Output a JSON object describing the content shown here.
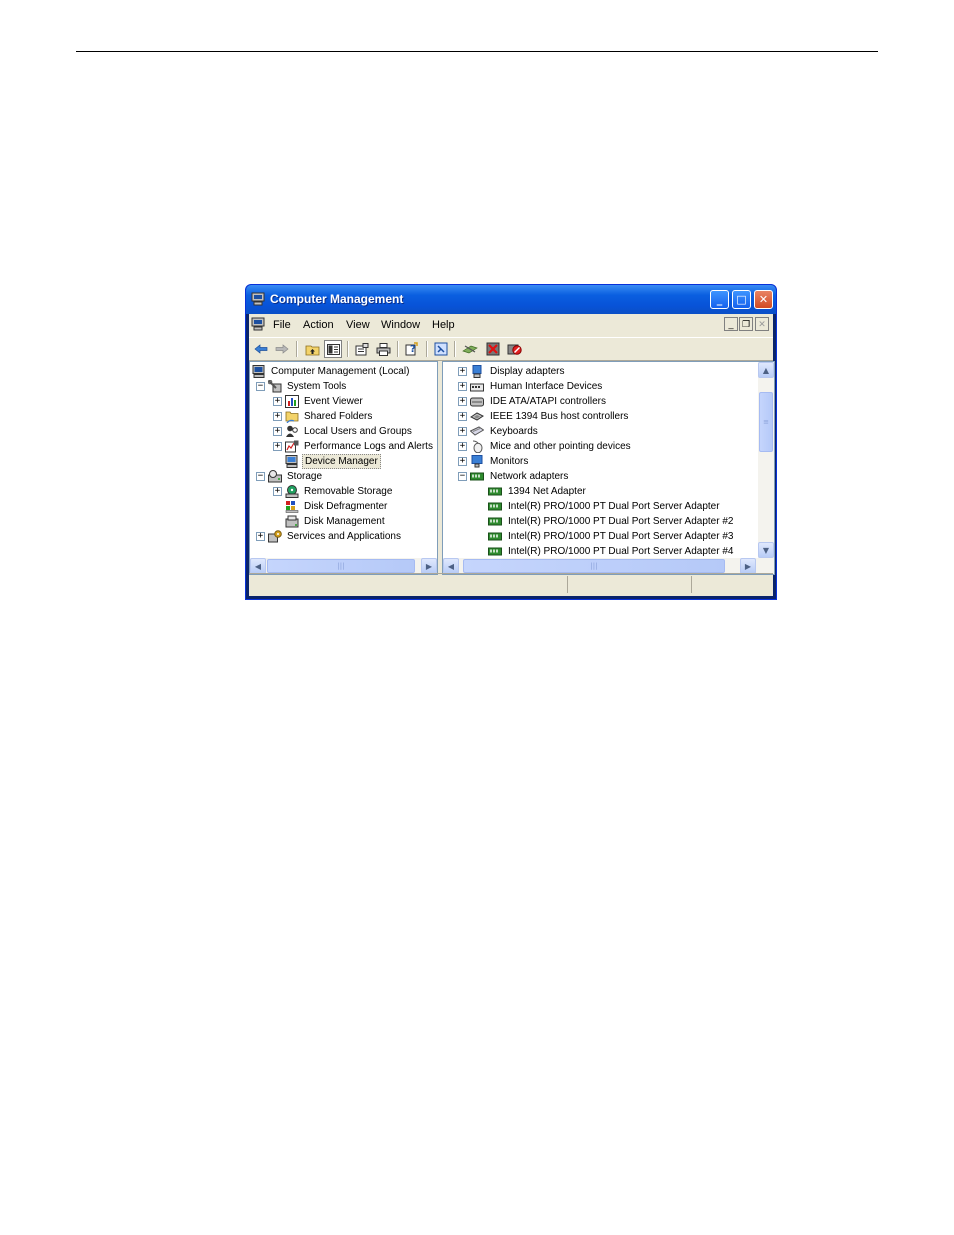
{
  "window": {
    "title": "Computer Management",
    "minimize_glyph": "_",
    "maximize_glyph": "□",
    "close_glyph": "✕"
  },
  "menu": {
    "items": [
      "File",
      "Action",
      "View",
      "Window",
      "Help"
    ],
    "mdi_minimize": "_",
    "mdi_restore": "❐",
    "mdi_close": "✕"
  },
  "toolbar": {
    "icons": [
      "back-arrow-icon",
      "forward-arrow-icon",
      "up-folder-icon",
      "show-hide-console-tree-icon",
      "properties-icon",
      "print-icon",
      "help-icon",
      "refresh-icon",
      "scan-hardware-icon",
      "uninstall-icon",
      "disable-icon"
    ]
  },
  "left_tree": {
    "root": "Computer Management (Local)",
    "system_tools": "System Tools",
    "event_viewer": "Event Viewer",
    "shared_folders": "Shared Folders",
    "local_users": "Local Users and Groups",
    "perf_logs": "Performance Logs and Alerts",
    "device_manager": "Device Manager",
    "storage": "Storage",
    "removable_storage": "Removable Storage",
    "disk_defrag": "Disk Defragmenter",
    "disk_mgmt": "Disk Management",
    "services_apps": "Services and Applications"
  },
  "right_tree": {
    "display_adapters": "Display adapters",
    "hid": "Human Interface Devices",
    "ide": "IDE ATA/ATAPI controllers",
    "ieee1394": "IEEE 1394 Bus host controllers",
    "keyboards": "Keyboards",
    "mice": "Mice and other pointing devices",
    "monitors": "Monitors",
    "network_adapters": "Network adapters",
    "adapter_1394": "1394 Net Adapter",
    "adapter_intel_1": "Intel(R) PRO/1000 PT Dual Port Server Adapter",
    "adapter_intel_2": "Intel(R) PRO/1000 PT Dual Port Server Adapter #2",
    "adapter_intel_3": "Intel(R) PRO/1000 PT Dual Port Server Adapter #3",
    "adapter_intel_4": "Intel(R) PRO/1000 PT Dual Port Server Adapter #4"
  },
  "expander": {
    "plus": "+",
    "minus": "−"
  },
  "scroll": {
    "up": "▲",
    "down": "▼",
    "left": "◀",
    "right": "▶",
    "grip_v": "≡",
    "grip_h": "|||"
  }
}
